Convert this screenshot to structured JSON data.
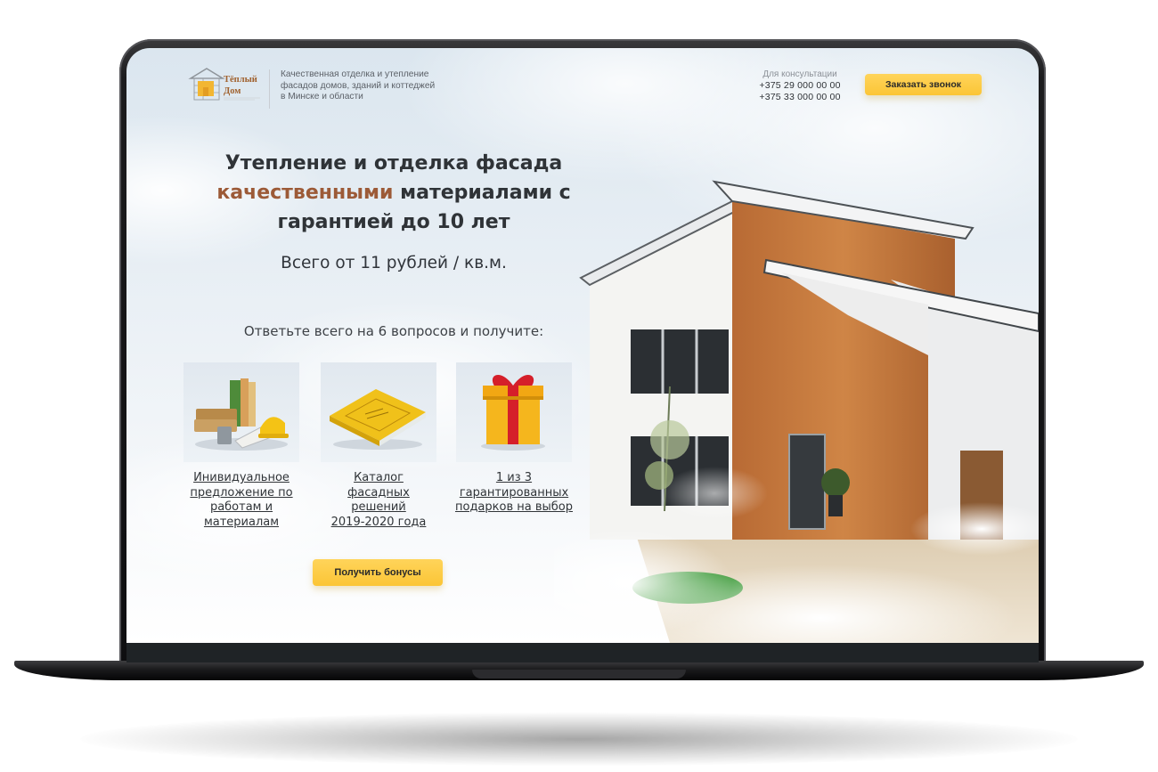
{
  "brand": {
    "logo_line1": "Тёплый",
    "logo_line2": "Дом"
  },
  "header": {
    "tagline": [
      "Качественная отделка и утепление",
      "фасадов домов, зданий и коттеджей",
      "в Минске и области"
    ],
    "consult_label": "Для консультации",
    "phones": [
      "+375 29 000 00 00",
      "+375 33 000 00 00"
    ],
    "call_button": "Заказать звонок"
  },
  "hero": {
    "title_line1": "Утепление и отделка фасада",
    "title_accent": "качественными",
    "title_line2_rest": " материалами с",
    "title_line3": "гарантией до 10 лет",
    "price": "Всего от 11 рублей / кв.м.",
    "questions": "Ответьте всего на 6 вопросов и получите:"
  },
  "bonuses": [
    {
      "icon": "building-materials-icon",
      "lines": [
        "Инивидуальное",
        "предложение по",
        "работам и",
        "материалам"
      ]
    },
    {
      "icon": "catalog-book-icon",
      "lines": [
        "Каталог",
        "фасадных",
        "решений",
        "2019-2020 года"
      ]
    },
    {
      "icon": "gift-box-icon",
      "lines": [
        "1 из 3",
        "гарантированных",
        "подарков на выбор"
      ]
    }
  ],
  "bonus_button": "Получить бонусы",
  "colors": {
    "accent": "#9c5a37",
    "button": "#fbc536",
    "text": "#2f3337"
  }
}
